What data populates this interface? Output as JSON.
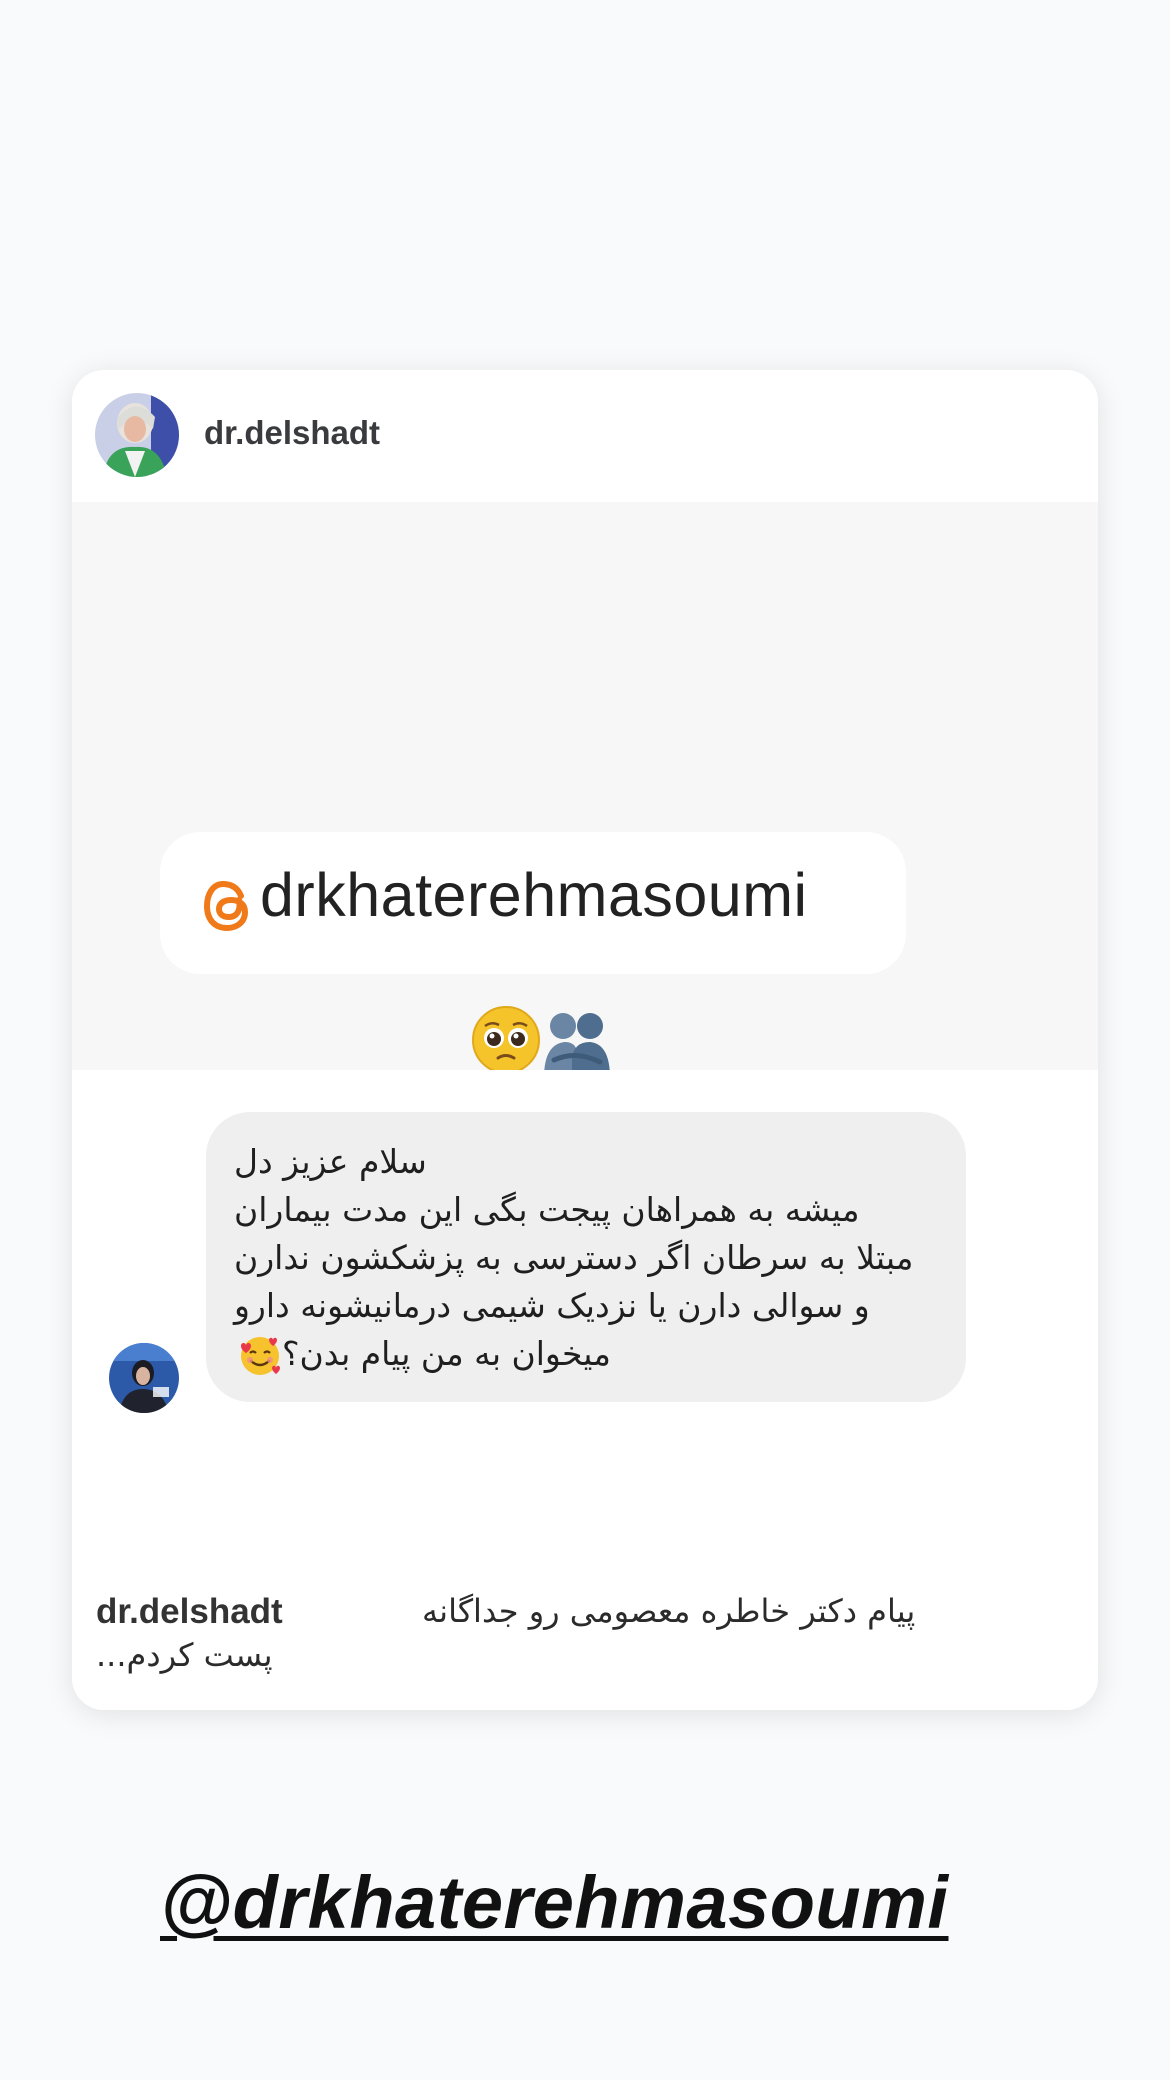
{
  "post": {
    "username": "dr.delshadt",
    "quoted_content": {
      "mention": "drkhaterehmasoumi",
      "emojis": [
        "pleading-face",
        "people-hugging"
      ]
    },
    "direct_message": {
      "lines": [
        "سلام عزیز دل",
        "میشه به همراهان پیجت بگی این مدت بیماران",
        "مبتلا به سرطان اگر دسترسی به پزشکشون ندارن",
        "و سوالی دارن یا نزدیک شیمی درمانیشونه دارو",
        "میخوان به من پیام بدن؟"
      ],
      "trailing_emoji": "smiling-face-with-hearts"
    },
    "caption": {
      "username": "dr.delshadt",
      "text_line1": "پیام دکتر خاطره معصومی رو جداگانه",
      "text_line2": "پست کردم..."
    }
  },
  "story_mention": "@drkhaterehmasoumi",
  "colors": {
    "background": "#f9fafb",
    "card": "#ffffff",
    "quoted_bg": "#f7f7f8",
    "bubble": "#efeff0",
    "threads_orange": "#f07a1a"
  }
}
